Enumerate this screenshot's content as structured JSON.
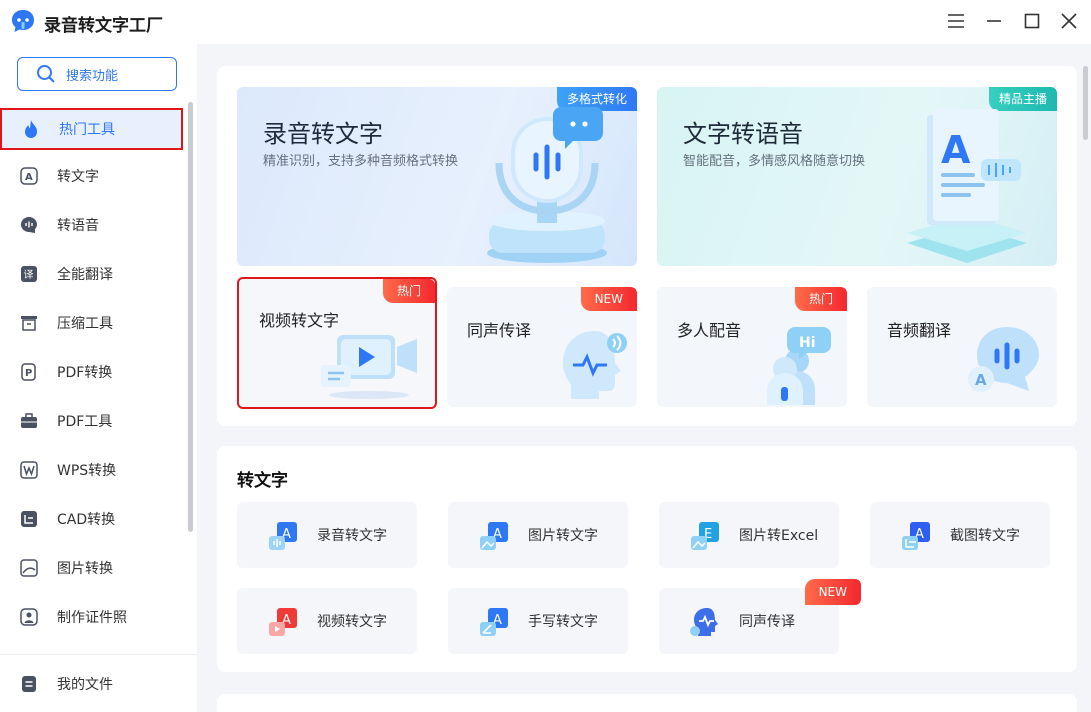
{
  "window": {
    "title": "录音转文字工厂"
  },
  "sidebar": {
    "search_label": "搜索功能",
    "items": [
      {
        "label": "热门工具",
        "icon": "flame-icon"
      },
      {
        "label": "转文字",
        "icon": "text-a-icon"
      },
      {
        "label": "转语音",
        "icon": "voice-icon"
      },
      {
        "label": "全能翻译",
        "icon": "translate-icon"
      },
      {
        "label": "压缩工具",
        "icon": "compress-icon"
      },
      {
        "label": "PDF转换",
        "icon": "pdf-convert-icon"
      },
      {
        "label": "PDF工具",
        "icon": "briefcase-icon"
      },
      {
        "label": "WPS转换",
        "icon": "wps-icon"
      },
      {
        "label": "CAD转换",
        "icon": "cad-icon"
      },
      {
        "label": "图片转换",
        "icon": "image-icon"
      },
      {
        "label": "制作证件照",
        "icon": "id-photo-icon"
      }
    ],
    "bottom_label": "我的文件"
  },
  "hot": {
    "big_cards": [
      {
        "title": "录音转文字",
        "subtitle": "精准识别，支持多种音频格式转换",
        "badge": "多格式转化"
      },
      {
        "title": "文字转语音",
        "subtitle": "智能配音，多情感风格随意切换",
        "badge": "精品主播"
      }
    ],
    "small_cards": [
      {
        "title": "视频转文字",
        "badge": "热门"
      },
      {
        "title": "同声传译",
        "badge": "NEW"
      },
      {
        "title": "多人配音",
        "badge": "热门"
      },
      {
        "title": "音频翻译",
        "badge": ""
      }
    ]
  },
  "section": {
    "title": "转文字",
    "tools": [
      {
        "label": "录音转文字",
        "letter": "A"
      },
      {
        "label": "图片转文字",
        "letter": "A"
      },
      {
        "label": "图片转Excel",
        "letter": "E"
      },
      {
        "label": "截图转文字",
        "letter": "A"
      },
      {
        "label": "视频转文字",
        "letter": "A"
      },
      {
        "label": "手写转文字",
        "letter": "A"
      },
      {
        "label": "同声传译",
        "letter": "",
        "badge": "NEW"
      }
    ]
  },
  "colors": {
    "accent": "#2f78f5",
    "highlight_border": "#e0161b",
    "badge_red": "#f3282e"
  }
}
